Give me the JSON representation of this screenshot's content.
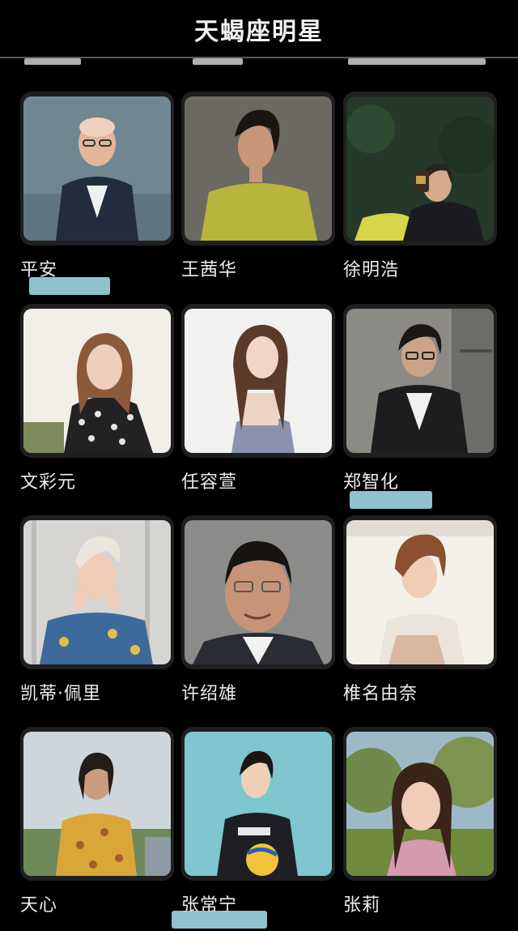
{
  "header": {
    "title": "天蝎座明星"
  },
  "celebrities": [
    {
      "name": "平安"
    },
    {
      "name": "王茜华"
    },
    {
      "name": "徐明浩"
    },
    {
      "name": "文彩元"
    },
    {
      "name": "任容萱"
    },
    {
      "name": "郑智化"
    },
    {
      "name": "凯蒂·佩里"
    },
    {
      "name": "许绍雄"
    },
    {
      "name": "椎名由奈"
    },
    {
      "name": "天心"
    },
    {
      "name": "张常宁"
    },
    {
      "name": "张莉"
    }
  ],
  "colors": {
    "background": "#000000",
    "card": "#1f1f1f",
    "text": "#ededed",
    "highlight_mark": "#9fd6e6"
  }
}
